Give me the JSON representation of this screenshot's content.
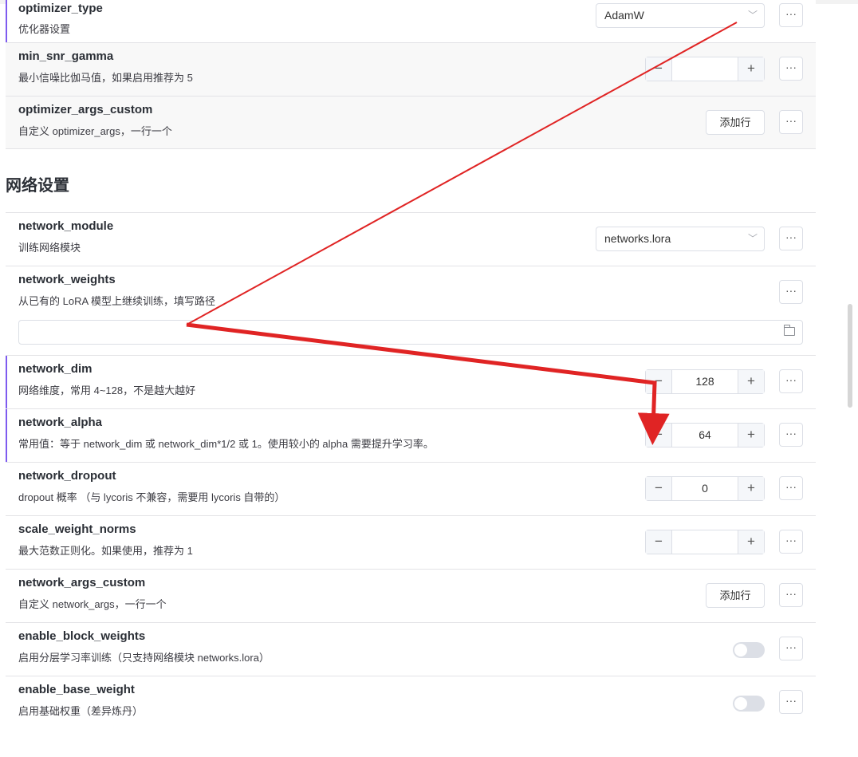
{
  "optimizer_section": {
    "rows": [
      {
        "key": "optimizer_type",
        "desc": "优化器设置",
        "control": "select",
        "value": "AdamW"
      },
      {
        "key": "min_snr_gamma",
        "desc": "最小信噪比伽马值，如果启用推荐为 5",
        "control": "stepper",
        "value": ""
      },
      {
        "key": "optimizer_args_custom",
        "desc": "自定义 optimizer_args，一行一个",
        "control": "add",
        "button": "添加行"
      }
    ]
  },
  "network_section": {
    "title": "网络设置",
    "network_module": {
      "key": "network_module",
      "desc": "训练网络模块",
      "value": "networks.lora"
    },
    "network_weights": {
      "key": "network_weights",
      "desc": "从已有的 LoRA 模型上继续训练，填写路径",
      "value": ""
    },
    "network_dim": {
      "key": "network_dim",
      "desc": "网络维度，常用 4~128，不是越大越好",
      "value": "128"
    },
    "network_alpha": {
      "key": "network_alpha",
      "desc": "常用值：等于 network_dim 或 network_dim*1/2 或 1。使用较小的 alpha 需要提升学习率。",
      "value": "64"
    },
    "network_dropout": {
      "key": "network_dropout",
      "desc": "dropout 概率 （与 lycoris 不兼容，需要用 lycoris 自带的）",
      "value": "0"
    },
    "scale_weight_norms": {
      "key": "scale_weight_norms",
      "desc": "最大范数正则化。如果使用，推荐为 1",
      "value": ""
    },
    "network_args_custom": {
      "key": "network_args_custom",
      "desc": "自定义 network_args，一行一个",
      "button": "添加行"
    },
    "enable_block_weights": {
      "key": "enable_block_weights",
      "desc": "启用分层学习率训练（只支持网络模块 networks.lora）",
      "on": false
    },
    "enable_base_weight": {
      "key": "enable_base_weight",
      "desc": "启用基础权重（差异炼丹）",
      "on": false
    }
  },
  "glyphs": {
    "more": "···",
    "minus": "−",
    "plus": "+",
    "chevron": "﹀"
  },
  "colors": {
    "modified_marker": "#7e5bef",
    "annotation_arrow": "#e02424"
  }
}
